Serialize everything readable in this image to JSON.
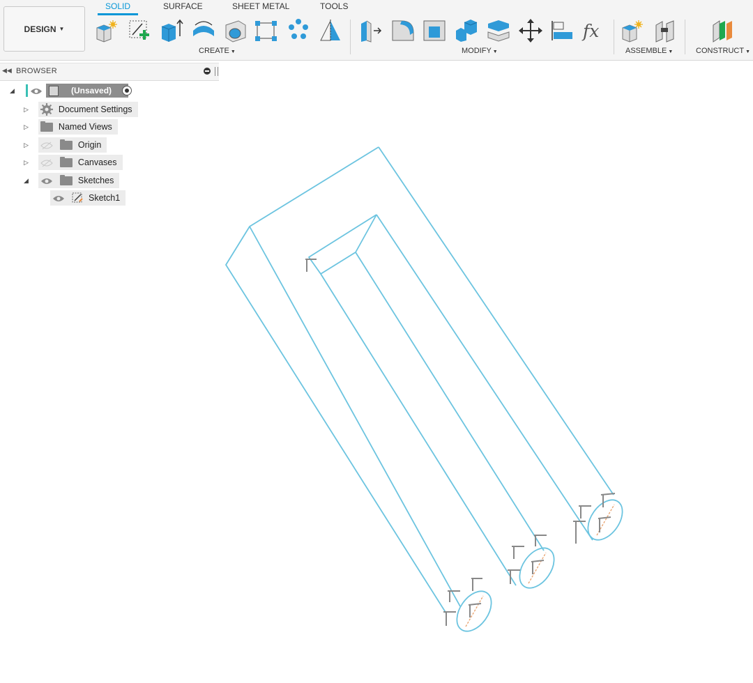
{
  "workspace": {
    "label": "DESIGN"
  },
  "tabs": [
    {
      "label": "SOLID",
      "active": true
    },
    {
      "label": "SURFACE",
      "active": false
    },
    {
      "label": "SHEET METAL",
      "active": false
    },
    {
      "label": "TOOLS",
      "active": false
    }
  ],
  "groups": {
    "create": "CREATE",
    "modify": "MODIFY",
    "assemble": "ASSEMBLE",
    "construct": "CONSTRUCT"
  },
  "tools": {
    "create": [
      "new-component-icon",
      "create-sketch-icon",
      "extrude-icon",
      "revolve-icon",
      "hole-icon",
      "rectangular-pattern-icon",
      "circular-pattern-icon",
      "mirror-icon"
    ],
    "modify": [
      "press-pull-icon",
      "fillet-icon",
      "shell-icon",
      "combine-icon",
      "split-body-icon",
      "move-icon",
      "align-icon",
      "parameters-fx-icon"
    ],
    "assemble": [
      "new-component-icon",
      "joint-icon"
    ],
    "construct": [
      "offset-plane-icon"
    ]
  },
  "browser": {
    "title": "BROWSER",
    "root": "(Unsaved)",
    "items": [
      {
        "label": "Document Settings",
        "icon": "gear-icon"
      },
      {
        "label": "Named Views",
        "icon": "folder-icon"
      },
      {
        "label": "Origin",
        "icon": "folder-icon"
      },
      {
        "label": "Canvases",
        "icon": "folder-icon"
      },
      {
        "label": "Sketches",
        "icon": "folder-icon"
      }
    ],
    "sketch": "Sketch1"
  },
  "colors": {
    "accent": "#0696d7",
    "edge": "#6cc4e0",
    "background": "#ffffff",
    "toolbar": "#f4f4f4",
    "tool_blue": "#2f9ad8",
    "constraint_orange": "#e8a06b"
  }
}
